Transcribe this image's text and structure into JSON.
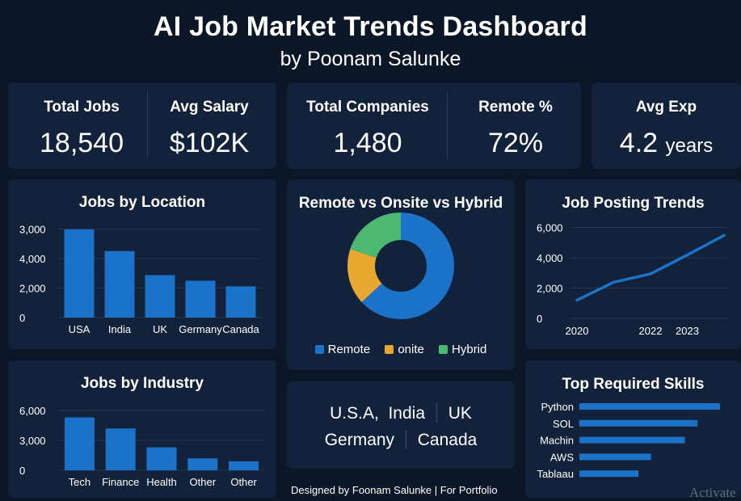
{
  "header": {
    "title": "AI Job Market Trends Dashboard",
    "subtitle": "by Poonam Salunke"
  },
  "kpis": {
    "total_jobs": {
      "label": "Total Jobs",
      "value": "18,540"
    },
    "avg_salary": {
      "label": "Avg Salary",
      "value": "$102K"
    },
    "total_companies": {
      "label": "Total Companies",
      "value": "1,480"
    },
    "remote_pct": {
      "label": "Remote %",
      "value": "72%"
    },
    "avg_exp": {
      "label": "Avg Exp",
      "value": "4.2",
      "unit": "years"
    }
  },
  "colors": {
    "bar": "#1a73c8",
    "remote": "#1a73c8",
    "onsite": "#e8a830",
    "hybrid": "#4cb872",
    "grid": "#243650",
    "card": "#12223a",
    "background": "#0b1626"
  },
  "countries_card": {
    "row1": [
      "U.S.A,",
      "India",
      "UK"
    ],
    "row2": [
      "Germany",
      "Canada"
    ]
  },
  "footer": "Designed by Foonam Salunke | For Portfolio",
  "watermark": "Activate",
  "chart_data": [
    {
      "id": "location",
      "type": "bar",
      "title": "Jobs by Location",
      "categories": [
        "USA",
        "India",
        "UK",
        "Germany",
        "Canada"
      ],
      "values": [
        5500,
        4150,
        2650,
        2300,
        1950
      ],
      "yticks": [
        "0",
        "2,000",
        "4,000",
        "3,000"
      ],
      "ylim": [
        0,
        6000
      ],
      "grid": true
    },
    {
      "id": "industry",
      "type": "bar",
      "title": "Jobs by Industry",
      "categories": [
        "Tech",
        "Finance",
        "Health",
        "Other",
        "Other"
      ],
      "values": [
        5300,
        4200,
        2300,
        1200,
        900
      ],
      "yticks": [
        "0",
        "3,000",
        "6,000"
      ],
      "ylim": [
        0,
        6000
      ],
      "grid": true
    },
    {
      "id": "worktype",
      "type": "pie",
      "title": "Remote vs Onsite vs Hybrid",
      "labels": [
        "Remote",
        "onite",
        "Hybrid"
      ],
      "values": [
        63,
        17,
        20
      ]
    },
    {
      "id": "trends",
      "type": "line",
      "title": "Job Posting Trends",
      "x": [
        2020,
        2021,
        2022,
        2023,
        2024
      ],
      "y": [
        1200,
        2400,
        2950,
        4200,
        5500
      ],
      "xticks": [
        "2020",
        "2022",
        "2023"
      ],
      "yticks": [
        "0",
        "2,000",
        "4,000",
        "6,000"
      ],
      "ylim": [
        0,
        6000
      ],
      "grid": true
    },
    {
      "id": "skills",
      "type": "bar",
      "orientation": "horizontal",
      "title": "Top Required Skills",
      "categories": [
        "Python",
        "SOL",
        "Machin",
        "AWS",
        "Tablaau"
      ],
      "values": [
        100,
        84,
        75,
        51,
        42
      ]
    }
  ]
}
